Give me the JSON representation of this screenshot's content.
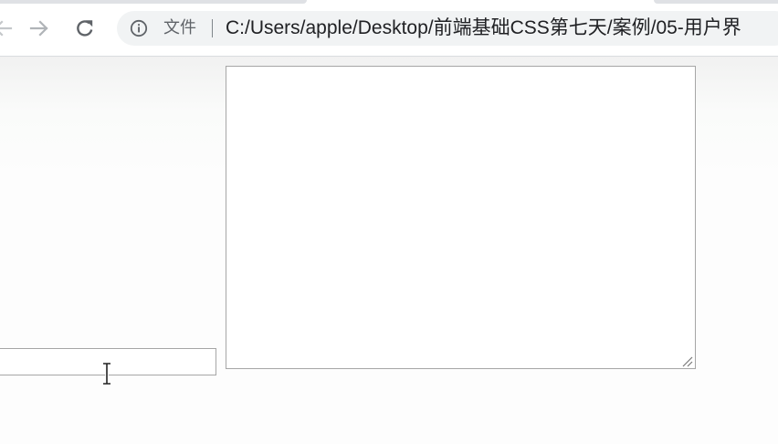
{
  "browser": {
    "back_icon": "arrow-left-icon",
    "forward_icon": "arrow-right-icon",
    "reload_icon": "reload-icon",
    "address_bar": {
      "security_icon": "info-icon",
      "security_label": "文件",
      "url": "C:/Users/apple/Desktop/前端基础CSS第七天/案例/05-用户界"
    }
  },
  "page": {
    "text_input": {
      "value": "",
      "placeholder": ""
    },
    "textarea": {
      "value": "",
      "placeholder": ""
    },
    "cursor": "text-cursor-icon"
  }
}
